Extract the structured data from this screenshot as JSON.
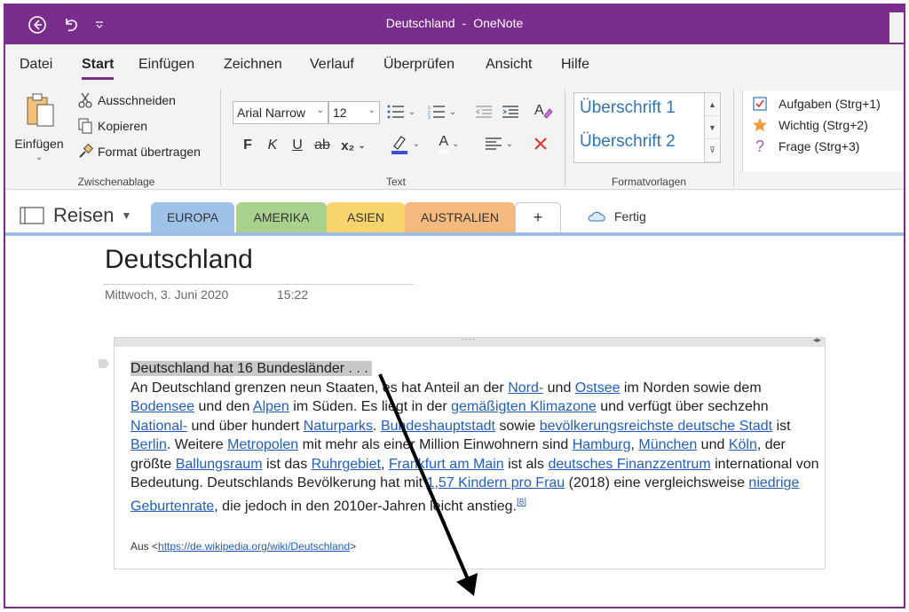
{
  "window": {
    "title_doc": "Deutschland",
    "title_sep": "-",
    "title_app": "OneNote"
  },
  "ribbon_tabs": [
    "Datei",
    "Start",
    "Einfügen",
    "Zeichnen",
    "Verlauf",
    "Überprüfen",
    "Ansicht",
    "Hilfe"
  ],
  "clipboard": {
    "paste": "Einfügen",
    "cut": "Ausschneiden",
    "copy": "Kopieren",
    "format_painter": "Format übertragen",
    "group": "Zwischenablage"
  },
  "text_group": {
    "font": "Arial Narrow",
    "size": "12",
    "bold": "F",
    "italic": "K",
    "underline": "U",
    "strike": "ab",
    "subscript": "x₂",
    "font_color": "A",
    "group": "Text"
  },
  "styles": {
    "h1": "Überschrift 1",
    "h2": "Überschrift 2",
    "group": "Formatvorlagen"
  },
  "tags": [
    {
      "label": "Aufgaben (Strg+1)",
      "icon": "checkbox-icon"
    },
    {
      "label": "Wichtig (Strg+2)",
      "icon": "star-icon"
    },
    {
      "label": "Frage (Strg+3)",
      "icon": "question-icon"
    }
  ],
  "notebook": {
    "name": "Reisen",
    "sections": [
      {
        "label": "EUROPA",
        "color": "#9fc2e8"
      },
      {
        "label": "AMERIKA",
        "color": "#a9d18e"
      },
      {
        "label": "ASIEN",
        "color": "#f6d46b"
      },
      {
        "label": "AUSTRALIEN",
        "color": "#f4b97c"
      }
    ],
    "add_section": "+",
    "status": "Fertig"
  },
  "page": {
    "title": "Deutschland",
    "date": "Mittwoch, 3. Juni 2020",
    "time": "15:22"
  },
  "note": {
    "heading": "Deutschland hat 16 Bundesländer . . .",
    "t1": "An Deutschland grenzen neun Staaten, es hat Anteil an der ",
    "l_nord": "Nord-",
    "t2": " und ",
    "l_ostsee": "Ostsee",
    "t3": " im Norden sowie dem ",
    "l_bodensee": "Bodensee",
    "t4": " und den ",
    "l_alpen": "Alpen",
    "t5": " im Süden. Es liegt in der ",
    "l_klima": "gemäßigten Klimazone",
    "t6": " und verfügt über sechzehn ",
    "l_national": "National-",
    "t7": " und über hundert ",
    "l_naturparks": "Naturparks",
    "t8": ". ",
    "l_hauptstadt": "Bundeshauptstadt",
    "t9": " sowie ",
    "l_bevoelk": "bevölkerungsreichste deutsche Stadt",
    "t10": " ist ",
    "l_berlin": "Berlin",
    "t11": ". Weitere ",
    "l_metropolen": "Metropolen",
    "t12": " mit mehr als einer Million Einwohnern sind ",
    "l_hamburg": "Hamburg",
    "t13": ", ",
    "l_muenchen": "München",
    "t14": " und ",
    "l_koeln": "Köln",
    "t15": ", der größte ",
    "l_ballungsraum": "Ballungsraum",
    "t16": " ist das ",
    "l_ruhrgebiet": "Ruhrgebiet",
    "t17": ", ",
    "l_frankfurt": "Frankfurt am Main",
    "t18": " ist als ",
    "l_finanz": "deutsches Finanzzentrum",
    "t19": " international von Bedeutung. Deutschlands Bevölkerung hat mit ",
    "l_kinder": "1,57 Kindern pro Frau",
    "t20": " (2018) eine vergleichsweise ",
    "l_geburten": "niedrige Geburtenrate",
    "t21": ", die jedoch in den 2010er-Jahren leicht anstieg.",
    "l_ref": "[8]",
    "source_prefix": "Aus <",
    "source_url": "https://de.wikipedia.org/wiki/Deutschland",
    "source_suffix": ">"
  },
  "colors": {
    "accent": "#7a2d8c",
    "link": "#1f5fbf",
    "heading_style": "#2e75b6"
  }
}
